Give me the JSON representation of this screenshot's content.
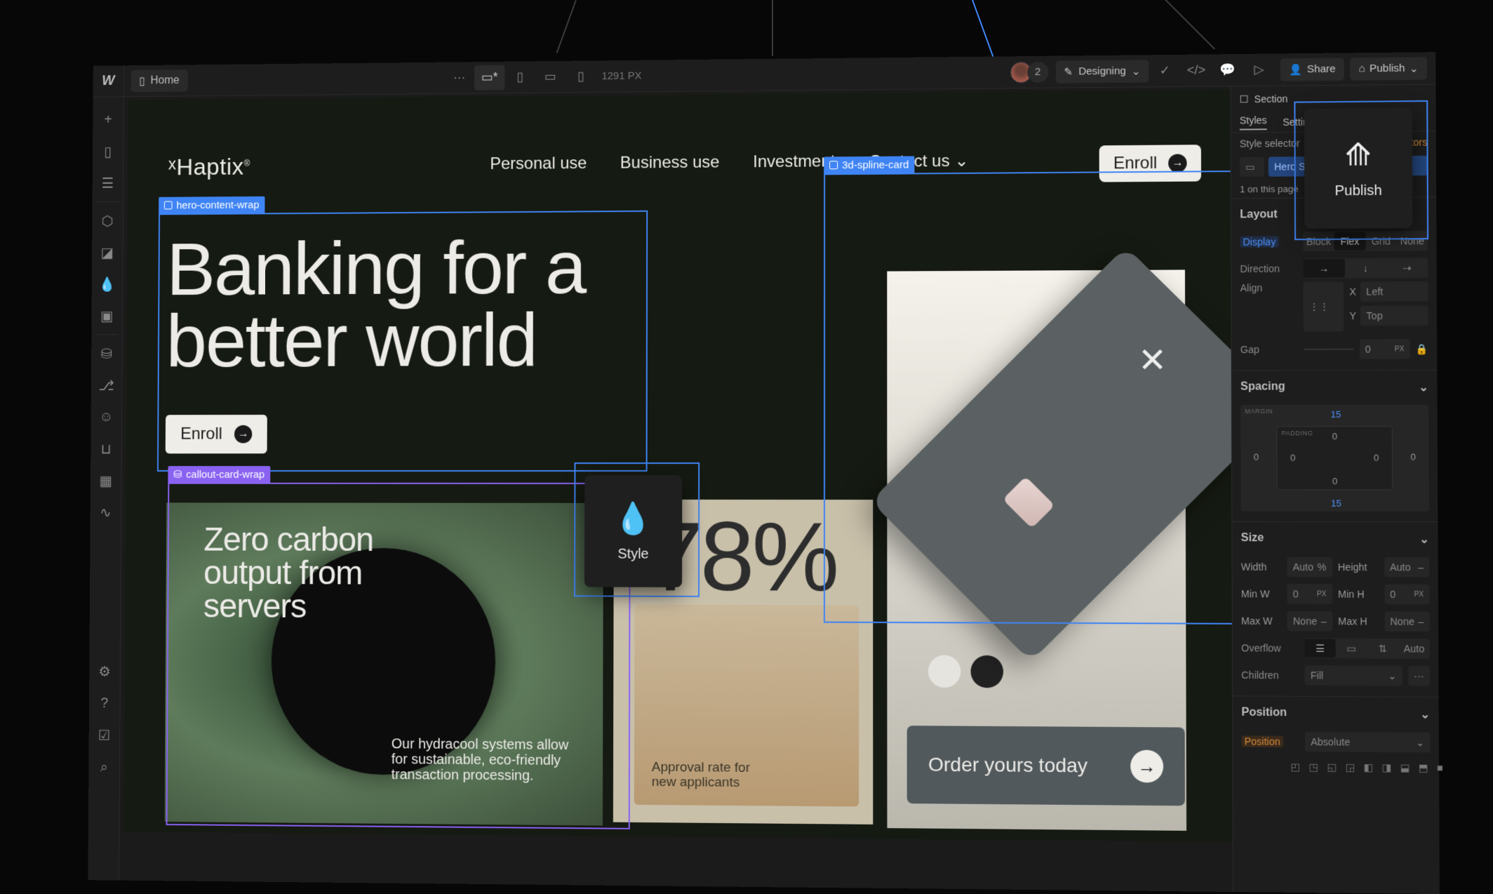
{
  "topbar": {
    "logo": "W",
    "page_label": "Home",
    "more_label": "···",
    "breakpoints": [
      {
        "name": "desktop-base",
        "glyph": "▭",
        "active": true
      },
      {
        "name": "tablet",
        "glyph": "▯",
        "active": false
      },
      {
        "name": "mobile-landscape",
        "glyph": "▭",
        "active": false
      },
      {
        "name": "mobile-portrait",
        "glyph": "▯",
        "active": false
      }
    ],
    "width_readout": "1291 PX",
    "collaborator_count": "2",
    "mode_label": "Designing",
    "share_label": "Share",
    "publish_label": "Publish"
  },
  "leftbar": {
    "icons": [
      "plus",
      "page",
      "navigator",
      "components",
      "assets",
      "variables",
      "media",
      "cms",
      "logic",
      "users",
      "ecommerce",
      "apps",
      "insights"
    ],
    "bottom_icons": [
      "settings",
      "help",
      "tasks",
      "search"
    ]
  },
  "site": {
    "brand": "Haptix",
    "brand_mark": "®",
    "nav": [
      "Personal use",
      "Business use",
      "Investment",
      "Contact us"
    ],
    "nav_enroll": "Enroll",
    "hero_title_line1": "Banking for a",
    "hero_title_line2": "better world",
    "hero_enroll": "Enroll",
    "green_card_title": "Zero carbon output from servers",
    "green_card_body": "Our hydracool systems allow for sustainable, eco-friendly transaction processing.",
    "stat_value": "78%",
    "stat_caption": "Approval rate for new applicants",
    "swatch_colors": [
      "#e6e4de",
      "#222222"
    ],
    "order_label": "Order yours today"
  },
  "selections": {
    "hero_tag": "hero-content-wrap",
    "callout_tag": "callout-card-wrap",
    "spline_tag": "3d-spline-card"
  },
  "floating_tools": {
    "style_label": "Style",
    "publish_label": "Publish"
  },
  "panel": {
    "element_type": "Section",
    "tabs": [
      "Styles",
      "Settings"
    ],
    "style_selector_label": "Style selector",
    "selectors_link": "Selectors",
    "selector_chip": "Hero Section",
    "selector_note": "1 on this page",
    "layout": {
      "title": "Layout",
      "display_label": "Display",
      "display_options": [
        "Block",
        "Flex",
        "Grid",
        "None"
      ],
      "display_selected": "Flex",
      "direction_label": "Direction",
      "direction_options": [
        "→",
        "↓",
        "⇢"
      ],
      "align_label": "Align",
      "align_x_label": "X",
      "align_x_value": "Left",
      "align_y_label": "Y",
      "align_y_value": "Top",
      "gap_label": "Gap",
      "gap_value": "0",
      "gap_unit": "PX"
    },
    "spacing": {
      "title": "Spacing",
      "margin_label": "MARGIN",
      "padding_label": "PADDING",
      "margin_top": "15",
      "margin_bottom": "15",
      "margin_left": "0",
      "margin_right": "0",
      "padding_top": "0",
      "padding_bottom": "0",
      "padding_left": "0",
      "padding_right": "0"
    },
    "size": {
      "title": "Size",
      "width_label": "Width",
      "width_value": "Auto",
      "width_unit": "%",
      "height_label": "Height",
      "height_value": "Auto",
      "height_unit": "–",
      "minw_label": "Min W",
      "minw_value": "0",
      "minw_unit": "PX",
      "minh_label": "Min H",
      "minh_value": "0",
      "minh_unit": "PX",
      "maxw_label": "Max W",
      "maxw_value": "None",
      "maxw_unit": "–",
      "maxh_label": "Max H",
      "maxh_value": "None",
      "maxh_unit": "–",
      "overflow_label": "Overflow",
      "overflow_auto": "Auto",
      "children_label": "Children",
      "children_value": "Fill",
      "more": "···"
    },
    "position": {
      "title": "Position",
      "label": "Position",
      "value": "Absolute"
    }
  },
  "colors": {
    "selection_blue": "#3f84f4",
    "selection_purple": "#8a62f2",
    "canvas_bg": "#151a12",
    "card_gray": "#5b6163"
  }
}
